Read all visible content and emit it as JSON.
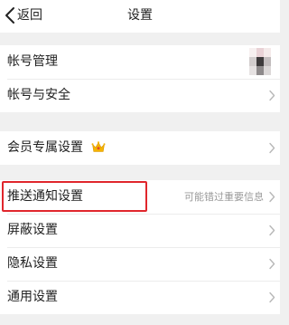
{
  "nav": {
    "back_label": "返回",
    "title": "设置"
  },
  "sections": [
    {
      "rows": [
        {
          "label": "帐号管理",
          "accessory": "avatar"
        },
        {
          "label": "帐号与安全",
          "accessory": "chevron"
        }
      ]
    },
    {
      "rows": [
        {
          "label": "会员专属设置",
          "accessory": "chevron",
          "badge": "crown-icon"
        }
      ]
    },
    {
      "rows": [
        {
          "label": "推送通知设置",
          "accessory": "chevron",
          "hint": "可能错过重要信息"
        },
        {
          "label": "屏蔽设置",
          "accessory": "chevron"
        },
        {
          "label": "隐私设置",
          "accessory": "chevron"
        },
        {
          "label": "通用设置",
          "accessory": "chevron"
        }
      ]
    }
  ],
  "annotation": {
    "color": "#e0262c"
  },
  "colors": {
    "background": "#f0f0f0",
    "surface": "#ffffff",
    "text": "#222222",
    "hint": "#9a9a9a",
    "chevron": "#b8b8b8",
    "crown": "#f5b400"
  }
}
